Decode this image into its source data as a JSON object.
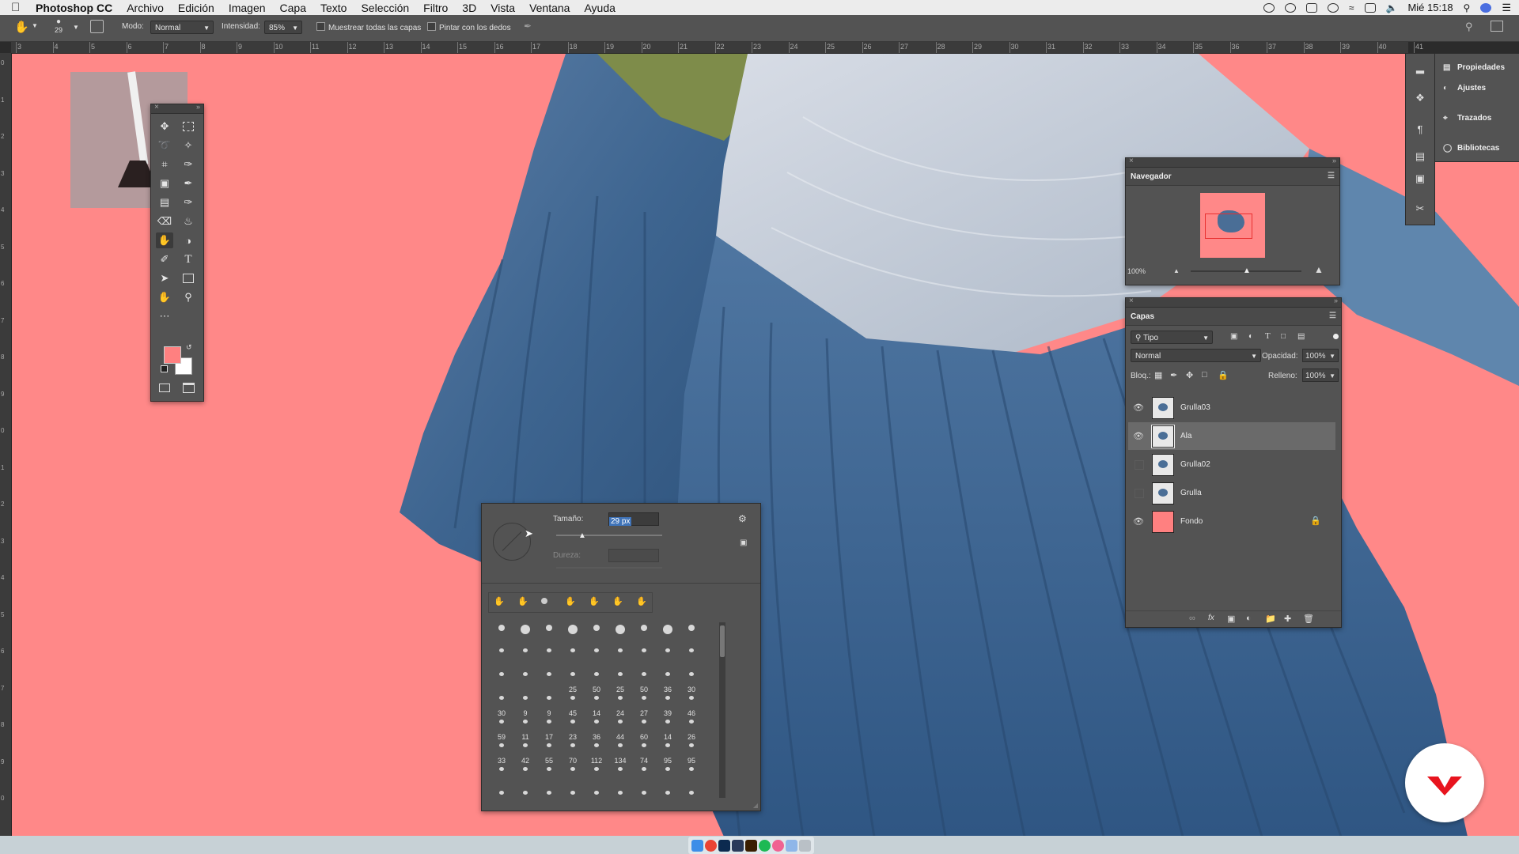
{
  "menubar": {
    "app_name": "Photoshop CC",
    "menus": [
      "Archivo",
      "Edición",
      "Imagen",
      "Capa",
      "Texto",
      "Selección",
      "Filtro",
      "3D",
      "Vista",
      "Ventana",
      "Ayuda"
    ],
    "clock": "Mié 15:18"
  },
  "options_bar": {
    "brush_size": "29",
    "mode_label": "Modo:",
    "mode_value": "Normal",
    "intensity_label": "Intensidad:",
    "intensity_value": "85%",
    "sample_all_label": "Muestrear todas las capas",
    "finger_paint_label": "Pintar con los dedos"
  },
  "ruler": {
    "top_labels": [
      "3",
      "4",
      "5",
      "6",
      "7",
      "8",
      "9",
      "10",
      "11",
      "12",
      "13",
      "14",
      "15",
      "16",
      "17",
      "18",
      "19",
      "20",
      "21",
      "22",
      "23",
      "24",
      "25",
      "26",
      "27",
      "28",
      "29",
      "30",
      "31",
      "32",
      "33",
      "34",
      "35",
      "36",
      "37",
      "38",
      "39",
      "40",
      "41"
    ],
    "left_labels": [
      "0",
      "1",
      "2",
      "3",
      "4",
      "5",
      "6",
      "7",
      "8",
      "9",
      "0",
      "1",
      "2",
      "3",
      "4",
      "5",
      "6",
      "7",
      "8",
      "9",
      "0"
    ]
  },
  "tools": {
    "foreground_color": "#ff8080",
    "background_color": "#ffffff"
  },
  "navigator": {
    "title": "Navegador",
    "zoom": "100%"
  },
  "layers": {
    "title": "Capas",
    "filter_kind": "Tipo",
    "blend_mode": "Normal",
    "opacity_label": "Opacidad:",
    "opacity_value": "100%",
    "lock_label": "Bloq.:",
    "fill_label": "Relleno:",
    "fill_value": "100%",
    "items": [
      {
        "name": "Grulla03",
        "visible": true,
        "selected": false,
        "locked": false
      },
      {
        "name": "Ala",
        "visible": true,
        "selected": true,
        "locked": false
      },
      {
        "name": "Grulla02",
        "visible": false,
        "selected": false,
        "locked": false
      },
      {
        "name": "Grulla",
        "visible": false,
        "selected": false,
        "locked": false
      },
      {
        "name": "Fondo",
        "visible": true,
        "selected": false,
        "locked": true
      }
    ]
  },
  "right_panel": {
    "items": [
      "Propiedades",
      "Ajustes",
      "Trazados",
      "Bibliotecas"
    ]
  },
  "brush_picker": {
    "size_label": "Tamaño:",
    "size_value": "29 px",
    "hardness_label": "Dureza:",
    "grid_numbers": [
      "25",
      "50",
      "25",
      "50",
      "36",
      "30",
      "30",
      "9",
      "9",
      "45",
      "14",
      "24",
      "27",
      "39",
      "46",
      "59",
      "11",
      "17",
      "23",
      "36",
      "44",
      "60",
      "14",
      "26",
      "33",
      "42",
      "55",
      "70",
      "112",
      "134",
      "74",
      "95",
      "95"
    ]
  },
  "colors": {
    "canvas_bg": "#ff8888",
    "panel_bg": "#535353",
    "accent_logo": "#e8141e"
  }
}
